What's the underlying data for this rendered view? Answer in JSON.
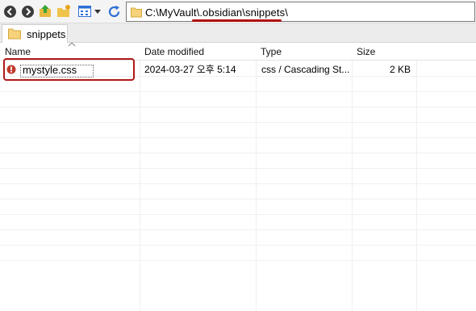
{
  "window": {
    "address_path": "C:\\MyVault\\.obsidian\\snippets\\"
  },
  "toolbar": {
    "icons": [
      "back-icon",
      "forward-icon",
      "up-folder-icon",
      "new-folder-icon",
      "view-icon",
      "view-dropdown-icon",
      "refresh-icon"
    ],
    "accent": "#2f6fd6"
  },
  "tab": {
    "label": "snippets"
  },
  "columns": {
    "name": "Name",
    "date": "Date modified",
    "type": "Type",
    "size": "Size"
  },
  "files": [
    {
      "name": "mystyle.css",
      "date": "2024-03-27 오후 5:14",
      "type": "css / Cascading St...",
      "size": "2 KB",
      "icon": "css-file-icon"
    }
  ],
  "highlight_color": "#b01818"
}
